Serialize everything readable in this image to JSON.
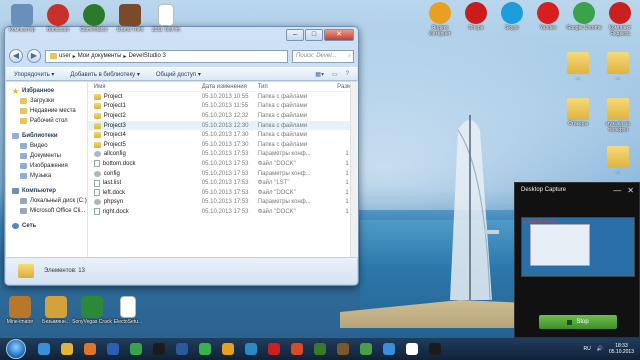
{
  "desktop": {
    "top_icons": [
      {
        "label": "Компьютер",
        "color": "#6a8fb8"
      },
      {
        "label": "Bandicam",
        "color": "#c9302c"
      },
      {
        "label": "GameMaker",
        "color": "#2a7a2a"
      },
      {
        "label": "Grand Theft",
        "color": "#7a4a2a"
      },
      {
        "label": "2011 Test Im",
        "color": "#ffffff"
      }
    ],
    "right_icons_row1": [
      {
        "label": "Яндекс Интернет",
        "color": "#e8a020"
      },
      {
        "label": "Опера",
        "color": "#cc1b1b"
      },
      {
        "label": "Skype",
        "color": "#1e9ddc"
      },
      {
        "label": "Yandex",
        "color": "#d81e1e"
      },
      {
        "label": "Google Chrome",
        "color": "#3aa24a"
      },
      {
        "label": "Комплект Яндекса",
        "color": "#cc2020"
      }
    ],
    "right_icons_col": [
      {
        "label": "..."
      },
      {
        "label": "..."
      },
      {
        "label": "Стикеры"
      },
      {
        "label": "музыка на телефон"
      },
      {
        "label": "..."
      }
    ],
    "bottom_icons": [
      {
        "label": "Mine-imator",
        "color": "#b9772c"
      },
      {
        "label": "Безымянн...",
        "color": "#d4a23a"
      },
      {
        "label": "SonyVegas Crack",
        "color": "#2a8a3a"
      },
      {
        "label": "ElectoSetu...",
        "color": "#ffffff"
      }
    ]
  },
  "explorer": {
    "controls": {
      "minimize": "–",
      "maximize": "□",
      "close": "✕"
    },
    "nav": {
      "back": "◀",
      "forward": "▶"
    },
    "address": [
      "user",
      "Мои документы",
      "DevelStudio 3"
    ],
    "search_placeholder": "Поиск: Devel...",
    "commands": [
      "Упорядочить ▾",
      "Добавить в библиотеку ▾",
      "Общий доступ ▾"
    ],
    "columns": {
      "name": "Имя",
      "date": "Дата изменения",
      "type": "Тип",
      "size": "Размер"
    },
    "navpane": [
      {
        "label": "Избранное",
        "kind": "head",
        "icon": "star"
      },
      {
        "label": "Загрузки",
        "kind": "sub",
        "icon": "fold"
      },
      {
        "label": "Недавние места",
        "kind": "sub",
        "icon": "fold"
      },
      {
        "label": "Рабочий стол",
        "kind": "sub",
        "icon": "fold"
      },
      {
        "label": "Библиотеки",
        "kind": "head",
        "icon": "lib"
      },
      {
        "label": "Видео",
        "kind": "sub",
        "icon": "lib"
      },
      {
        "label": "Документы",
        "kind": "sub",
        "icon": "lib"
      },
      {
        "label": "Изображения",
        "kind": "sub",
        "icon": "lib"
      },
      {
        "label": "Музыка",
        "kind": "sub",
        "icon": "lib"
      },
      {
        "label": "Компьютер",
        "kind": "head",
        "icon": "pc"
      },
      {
        "label": "Локальный диск (C:)",
        "kind": "sub",
        "icon": "drive"
      },
      {
        "label": "Microsoft Office Cli...",
        "kind": "sub",
        "icon": "drive"
      },
      {
        "label": "Сеть",
        "kind": "head",
        "icon": "net"
      }
    ],
    "files": [
      {
        "name": "Project",
        "date": "05.10.2013 10:55",
        "type": "Папка с файлами",
        "size": "",
        "icon": "folder"
      },
      {
        "name": "Project1",
        "date": "05.10.2013 11:55",
        "type": "Папка с файлами",
        "size": "",
        "icon": "folder"
      },
      {
        "name": "Project2",
        "date": "05.10.2013 12:32",
        "type": "Папка с файлами",
        "size": "",
        "icon": "folder"
      },
      {
        "name": "Project3",
        "date": "05.10.2013 12:30",
        "type": "Папка с файлами",
        "size": "",
        "icon": "folder"
      },
      {
        "name": "Project4",
        "date": "05.10.2013 17:30",
        "type": "Папка с файлами",
        "size": "",
        "icon": "folder"
      },
      {
        "name": "Project5",
        "date": "05.10.2013 17:30",
        "type": "Папка с файлами",
        "size": "",
        "icon": "folder"
      },
      {
        "name": "allconfig",
        "date": "05.10.2013 17:53",
        "type": "Параметры конф...",
        "size": "1 КБ",
        "icon": "gear"
      },
      {
        "name": "bottom.dock",
        "date": "05.10.2013 17:53",
        "type": "Файл \"DOCK\"",
        "size": "1 КБ",
        "icon": "file"
      },
      {
        "name": "config",
        "date": "05.10.2013 17:53",
        "type": "Параметры конф...",
        "size": "1 КБ",
        "icon": "gear"
      },
      {
        "name": "last.list",
        "date": "05.10.2013 17:53",
        "type": "Файл \"LST\"",
        "size": "1 КБ",
        "icon": "file"
      },
      {
        "name": "left.dock",
        "date": "05.10.2013 17:53",
        "type": "Файл \"DOCK\"",
        "size": "1 КБ",
        "icon": "file"
      },
      {
        "name": "phpsyn",
        "date": "05.10.2013 17:53",
        "type": "Параметры конф...",
        "size": "1 КБ",
        "icon": "gear"
      },
      {
        "name": "right.dock",
        "date": "05.10.2013 17:53",
        "type": "Файл \"DOCK\"",
        "size": "1 КБ",
        "icon": "file"
      }
    ],
    "status": "Элементов: 13"
  },
  "capture": {
    "title": "Desktop Capture",
    "controls": {
      "minimize": "—",
      "close": "✕"
    },
    "rec": "● REC 00:00:18",
    "stop_label": "Stop"
  },
  "taskbar": {
    "apps": [
      {
        "name": "ie",
        "color": "#3a8fd8"
      },
      {
        "name": "explorer",
        "color": "#e3b33a"
      },
      {
        "name": "media",
        "color": "#e0742a"
      },
      {
        "name": "word",
        "color": "#2b5fb4"
      },
      {
        "name": "app5",
        "color": "#3aa24a"
      },
      {
        "name": "app6",
        "color": "#1b1b1b"
      },
      {
        "name": "app7",
        "color": "#2a5a9a"
      },
      {
        "name": "app8",
        "color": "#3ab24a"
      },
      {
        "name": "app9",
        "color": "#e8a020"
      },
      {
        "name": "app10",
        "color": "#2a8ac8"
      },
      {
        "name": "app11",
        "color": "#cc2020"
      },
      {
        "name": "app12",
        "color": "#d84a2a"
      },
      {
        "name": "app13",
        "color": "#3a7a2a"
      },
      {
        "name": "app14",
        "color": "#7a5a2a"
      },
      {
        "name": "app15",
        "color": "#4aa04a"
      },
      {
        "name": "app16",
        "color": "#3a8fd8"
      },
      {
        "name": "app17",
        "color": "#ffffff"
      },
      {
        "name": "app18",
        "color": "#1b1b1b"
      }
    ],
    "lang": "RU",
    "time": "18:33",
    "date": "05.10.2013"
  }
}
